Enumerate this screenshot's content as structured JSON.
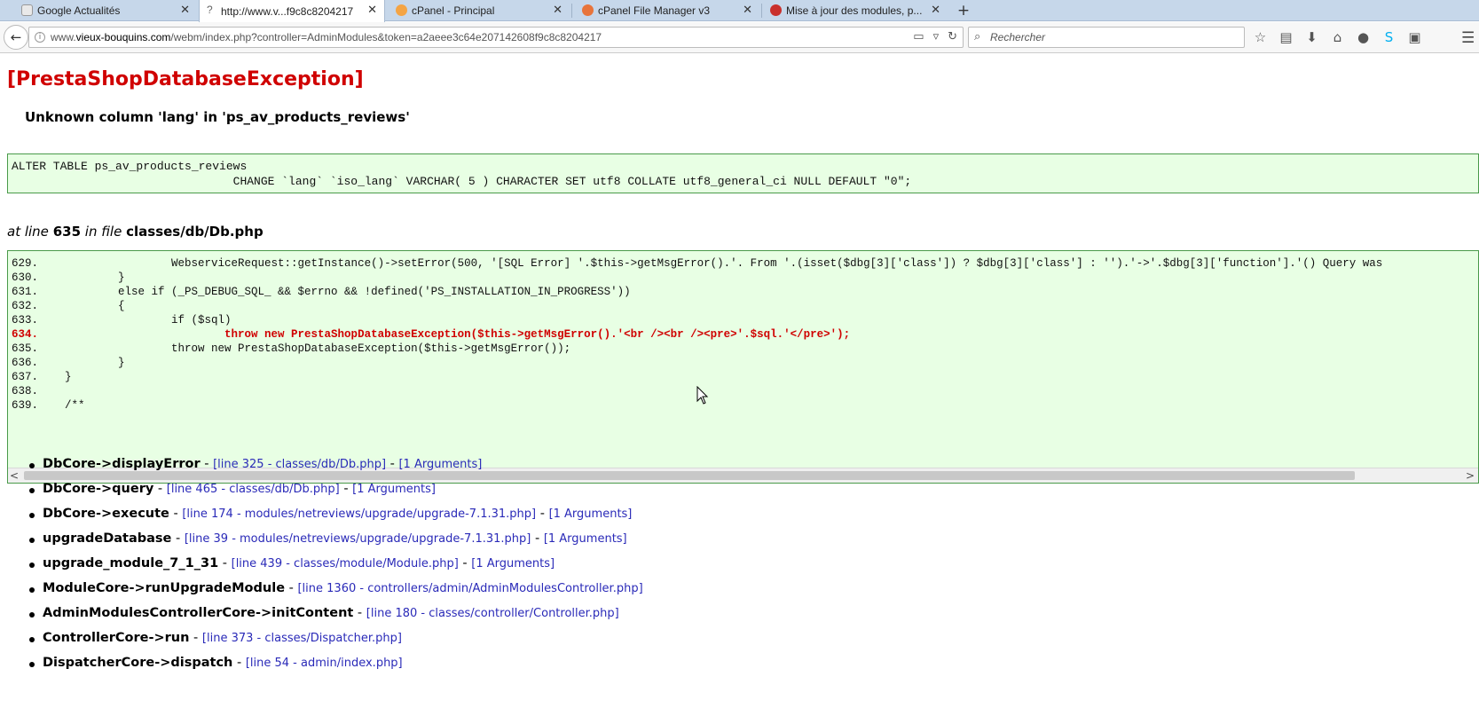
{
  "browser": {
    "tabs": [
      {
        "title": "Google Actualités",
        "active": false
      },
      {
        "title": "http://www.v...f9c8c8204217",
        "active": true
      },
      {
        "title": "cPanel - Principal",
        "active": false
      },
      {
        "title": "cPanel File Manager v3",
        "active": false
      },
      {
        "title": "Mise à jour des modules, p...",
        "active": false
      }
    ],
    "new_tab_label": "+",
    "url": {
      "prefix": "www.",
      "host": "vieux-bouquins.com",
      "path": "/webm/index.php?controller=AdminModules&token=a2aeee3c64e207142608f9c8c8204217"
    },
    "search_placeholder": "Rechercher",
    "toolbar_icons": [
      "star-icon",
      "reading-list-icon",
      "download-icon",
      "home-icon",
      "chat-icon",
      "skype-icon",
      "screenshot-icon"
    ]
  },
  "page": {
    "exception_title": "[PrestaShopDatabaseException]",
    "exception_message": "Unknown column 'lang' in 'ps_av_products_reviews'",
    "sql_lines": [
      "ALTER TABLE ps_av_products_reviews",
      "                                CHANGE `lang` `iso_lang` VARCHAR( 5 ) CHARACTER SET utf8 COLLATE utf8_general_ci NULL DEFAULT \"0\";"
    ],
    "at_line": {
      "prefix": "at line",
      "line": "635",
      "middle": "in file",
      "file": "classes/db/Db.php"
    },
    "source_lines": [
      {
        "text": "629.                    WebserviceRequest::getInstance()->setError(500, '[SQL Error] '.$this->getMsgError().'. From '.(isset($dbg[3]['class']) ? $dbg[3]['class'] : '').'->'.$dbg[3]['function'].'() Query was",
        "highlight": false
      },
      {
        "text": "630.            }",
        "highlight": false
      },
      {
        "text": "631.            else if (_PS_DEBUG_SQL_ && $errno && !defined('PS_INSTALLATION_IN_PROGRESS'))",
        "highlight": false
      },
      {
        "text": "632.            {",
        "highlight": false
      },
      {
        "text": "633.                    if ($sql)",
        "highlight": false
      },
      {
        "text": "634.                            throw new PrestaShopDatabaseException($this->getMsgError().'<br /><br /><pre>'.$sql.'</pre>');",
        "highlight": true
      },
      {
        "text": "635.                    throw new PrestaShopDatabaseException($this->getMsgError());",
        "highlight": false
      },
      {
        "text": "636.            }",
        "highlight": false
      },
      {
        "text": "637.    }",
        "highlight": false
      },
      {
        "text": "638.",
        "highlight": false
      },
      {
        "text": "639.    /**",
        "highlight": false
      }
    ],
    "scroll_left": "<",
    "scroll_right": ">",
    "stack_trace": [
      {
        "func": "DbCore->displayError",
        "location": "[line 325 - classes/db/Db.php]",
        "args": "[1 Arguments]"
      },
      {
        "func": "DbCore->query",
        "location": "[line 465 - classes/db/Db.php]",
        "args": "[1 Arguments]"
      },
      {
        "func": "DbCore->execute",
        "location": "[line 174 - modules/netreviews/upgrade/upgrade-7.1.31.php]",
        "args": "[1 Arguments]"
      },
      {
        "func": "upgradeDatabase",
        "location": "[line 39 - modules/netreviews/upgrade/upgrade-7.1.31.php]",
        "args": "[1 Arguments]"
      },
      {
        "func": "upgrade_module_7_1_31",
        "location": "[line 439 - classes/module/Module.php]",
        "args": "[1 Arguments]"
      },
      {
        "func": "ModuleCore->runUpgradeModule",
        "location": "[line 1360 - controllers/admin/AdminModulesController.php]",
        "args": ""
      },
      {
        "func": "AdminModulesControllerCore->initContent",
        "location": "[line 180 - classes/controller/Controller.php]",
        "args": ""
      },
      {
        "func": "ControllerCore->run",
        "location": "[line 373 - classes/Dispatcher.php]",
        "args": ""
      },
      {
        "func": "DispatcherCore->dispatch",
        "location": "[line 54 - admin/index.php]",
        "args": ""
      }
    ],
    "separator": "-"
  },
  "colors": {
    "error_red": "#d00000",
    "code_bg": "#e8ffe4",
    "code_border": "#4a9a4a",
    "link_blue": "#2a2ab8",
    "tabstrip_bg": "#c6d7ea"
  }
}
